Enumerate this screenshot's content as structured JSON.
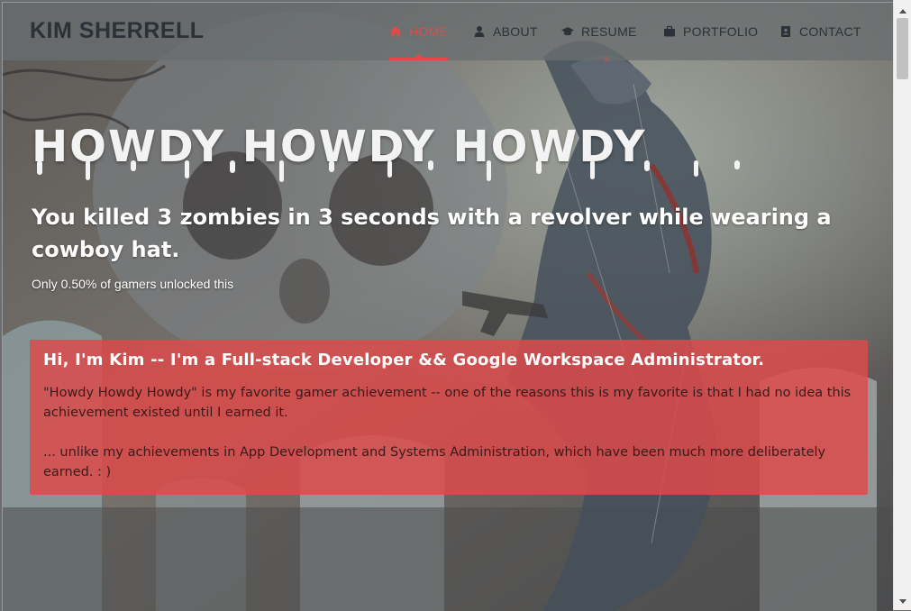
{
  "brand": "KIM SHERRELL",
  "nav": [
    {
      "label": "HOME",
      "icon": "home-icon",
      "active": true
    },
    {
      "label": "ABOUT",
      "icon": "user-icon",
      "active": false
    },
    {
      "label": "RESUME",
      "icon": "graduation-cap-icon",
      "active": false
    },
    {
      "label": "PORTFOLIO",
      "icon": "briefcase-icon",
      "active": false
    },
    {
      "label": "CONTACT",
      "icon": "address-book-icon",
      "active": false
    }
  ],
  "hero": {
    "title": "HOWDY HOWDY HOWDY",
    "subtitle": "You killed 3 zombies in 3 seconds with a revolver while wearing a cowboy hat.",
    "stat": "Only 0.50% of gamers unlocked this"
  },
  "intro": {
    "heading": "Hi, I'm Kim -- I'm a Full-stack Developer && Google Workspace Administrator.",
    "paragraph1": "\"Howdy Howdy Howdy\" is my favorite gamer achievement -- one of the reasons this is my favorite is that I had no idea this achievement existed until I earned it.",
    "paragraph2": "... unlike my achievements in App Development and Systems Administration, which have been much more deliberately earned.    :  )"
  },
  "colors": {
    "accent": "#e24a4a",
    "card": "#de4a4a",
    "nav_text": "#2a3238"
  }
}
